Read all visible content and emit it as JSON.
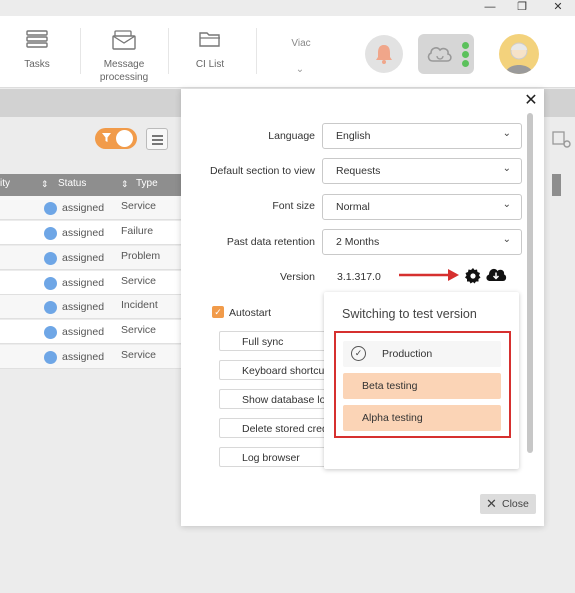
{
  "window": {
    "minimize": "—",
    "restore": "❐",
    "close": "✕"
  },
  "toolbar": {
    "tasks": "Tasks",
    "message_line1": "Message",
    "message_line2": "processing",
    "ci_list": "CI List",
    "viac": "Viac",
    "viac_chevron": "⌄"
  },
  "table": {
    "col_ity": "ity",
    "col_status": "Status",
    "col_type": "Type",
    "sort_arrow": "⇕",
    "rows": [
      {
        "status": "assigned",
        "type": "Service"
      },
      {
        "status": "assigned",
        "type": "Failure"
      },
      {
        "status": "assigned",
        "type": "Problem"
      },
      {
        "status": "assigned",
        "type": "Service"
      },
      {
        "status": "assigned",
        "type": "Incident"
      },
      {
        "status": "assigned",
        "type": "Service"
      },
      {
        "status": "assigned",
        "type": "Service"
      }
    ]
  },
  "settings": {
    "language_label": "Language",
    "language_value": "English",
    "default_section_label": "Default section to view",
    "default_section_value": "Requests",
    "font_size_label": "Font size",
    "font_size_value": "Normal",
    "retention_label": "Past data retention",
    "retention_value": "2 Months",
    "version_label": "Version",
    "version_value": "3.1.317.0",
    "autostart_label": "Autostart",
    "autostart_checked": true,
    "buttons": [
      "Full sync",
      "Keyboard shortcuts",
      "Show database location",
      "Delete stored credentials",
      "Log browser"
    ],
    "close_label": "Close"
  },
  "version_popup": {
    "title": "Switching to test version",
    "options": [
      {
        "label": "Production",
        "selected": true
      },
      {
        "label": "Beta testing",
        "selected": false
      },
      {
        "label": "Alpha testing",
        "selected": false
      }
    ]
  },
  "colors": {
    "accent_orange": "#f19b4a",
    "option_highlight": "#fbd4b6",
    "annotation_red": "#d6302f",
    "status_dot_blue": "#6ea6e6"
  },
  "icons": {
    "chevron": "⌄",
    "check": "✓",
    "dialog_close": "✕",
    "close_button": "✕"
  }
}
